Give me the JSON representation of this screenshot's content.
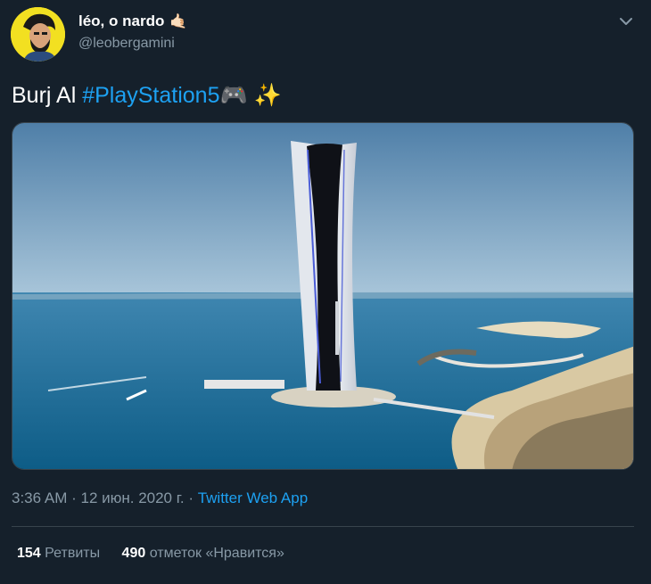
{
  "author": {
    "display_name": "léo, o nardo",
    "name_emoji": "🤙🏻",
    "handle": "@leobergamini",
    "avatar_icon": "avatar-cartoon-portrait"
  },
  "tweet": {
    "text_plain": "Burj Al ",
    "hashtag": "#PlayStation5",
    "emoji": "🎮 ✨"
  },
  "media": {
    "icon": "photo-ps5-tower-in-dubai-sea"
  },
  "meta": {
    "time": "3:36 AM",
    "separator1": " · ",
    "date": "12 июн. 2020 г.",
    "separator2": " · ",
    "app": "Twitter Web App"
  },
  "stats": {
    "retweets_count": "154",
    "retweets_label": "Ретвиты",
    "likes_count": "490",
    "likes_label": "отметок «Нравится»"
  },
  "colors": {
    "background": "#15202b",
    "link": "#1da1f2",
    "secondary_text": "#8899a6",
    "divider": "#38444d"
  }
}
